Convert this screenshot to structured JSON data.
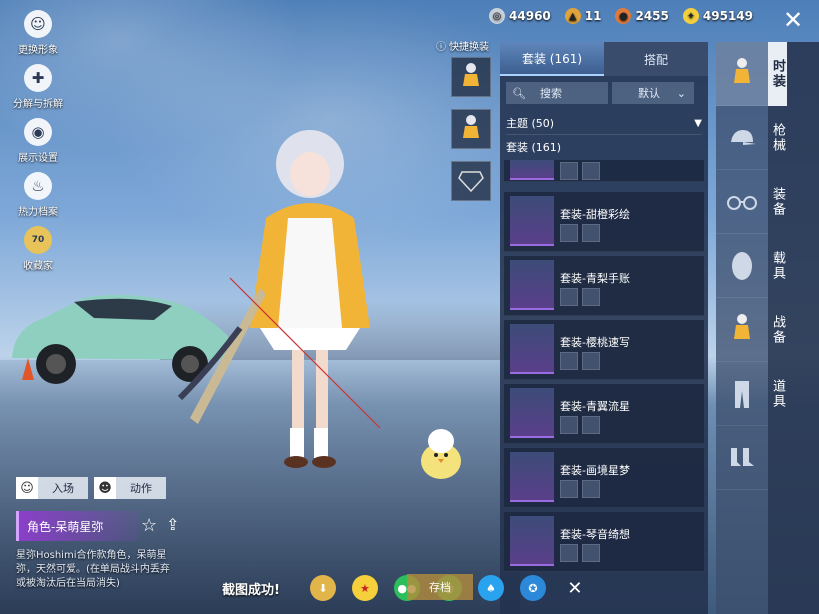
{
  "left_menu": [
    {
      "label": "更换形象",
      "icon": "avatar-icon"
    },
    {
      "label": "分解与拆解",
      "icon": "puzzle-icon"
    },
    {
      "label": "展示设置",
      "icon": "eye-icon"
    },
    {
      "label": "热力档案",
      "icon": "flame-icon"
    },
    {
      "label": "收藏家",
      "icon": "collector-badge-icon",
      "badge": "70"
    }
  ],
  "resources": [
    {
      "value": "44960",
      "icon": "silver-coin-icon",
      "color": "#c8d0dc"
    },
    {
      "value": "11",
      "icon": "gold-token-icon",
      "color": "#e0a33a"
    },
    {
      "value": "2455",
      "icon": "bronze-coin-icon",
      "color": "#e07a3a"
    },
    {
      "value": "495149",
      "icon": "uc-coin-icon",
      "color": "#f3cf3d"
    }
  ],
  "quick_change": {
    "label": "快捷换装"
  },
  "tabs": {
    "active": "套装 (161)",
    "inactive": "搭配"
  },
  "search": {
    "label": "搜索",
    "sort": "默认"
  },
  "theme": {
    "label": "主题 (50)"
  },
  "suit_count": "套装 (161)",
  "suits": [
    {
      "name": "套装-甜橙彩绘"
    },
    {
      "name": "套装-青梨手账"
    },
    {
      "name": "套装-樱桃速写"
    },
    {
      "name": "套装-青翼流星"
    },
    {
      "name": "套装-画境星梦"
    },
    {
      "name": "套装-琴音绮想"
    }
  ],
  "categories": [
    {
      "label": "时装",
      "icon": "outfit-icon"
    },
    {
      "label": "枪械",
      "icon": "cap-icon"
    },
    {
      "label": "装备",
      "icon": "glasses-icon"
    },
    {
      "label": "载具",
      "icon": "face-icon"
    },
    {
      "label": "战备",
      "icon": "figure-icon"
    },
    {
      "label": "道具",
      "icon": "pants-icon"
    },
    {
      "label": "",
      "icon": "boots-icon"
    }
  ],
  "buttons": {
    "enter": "入场",
    "action": "动作"
  },
  "character": {
    "name": "角色-呆萌星弥",
    "description": "星弥Hoshimi合作款角色，呆萌星弥，天然可爱。(在单局战斗内丢弃或被淘汰后在当局消失)"
  },
  "share_bar": {
    "text": "截图成功!",
    "save": "存档",
    "icons": [
      "gold-circle-icon",
      "peace-elite-icon",
      "wechat-icon",
      "moments-icon",
      "qq-icon",
      "qzone-icon",
      "close-icon"
    ]
  }
}
